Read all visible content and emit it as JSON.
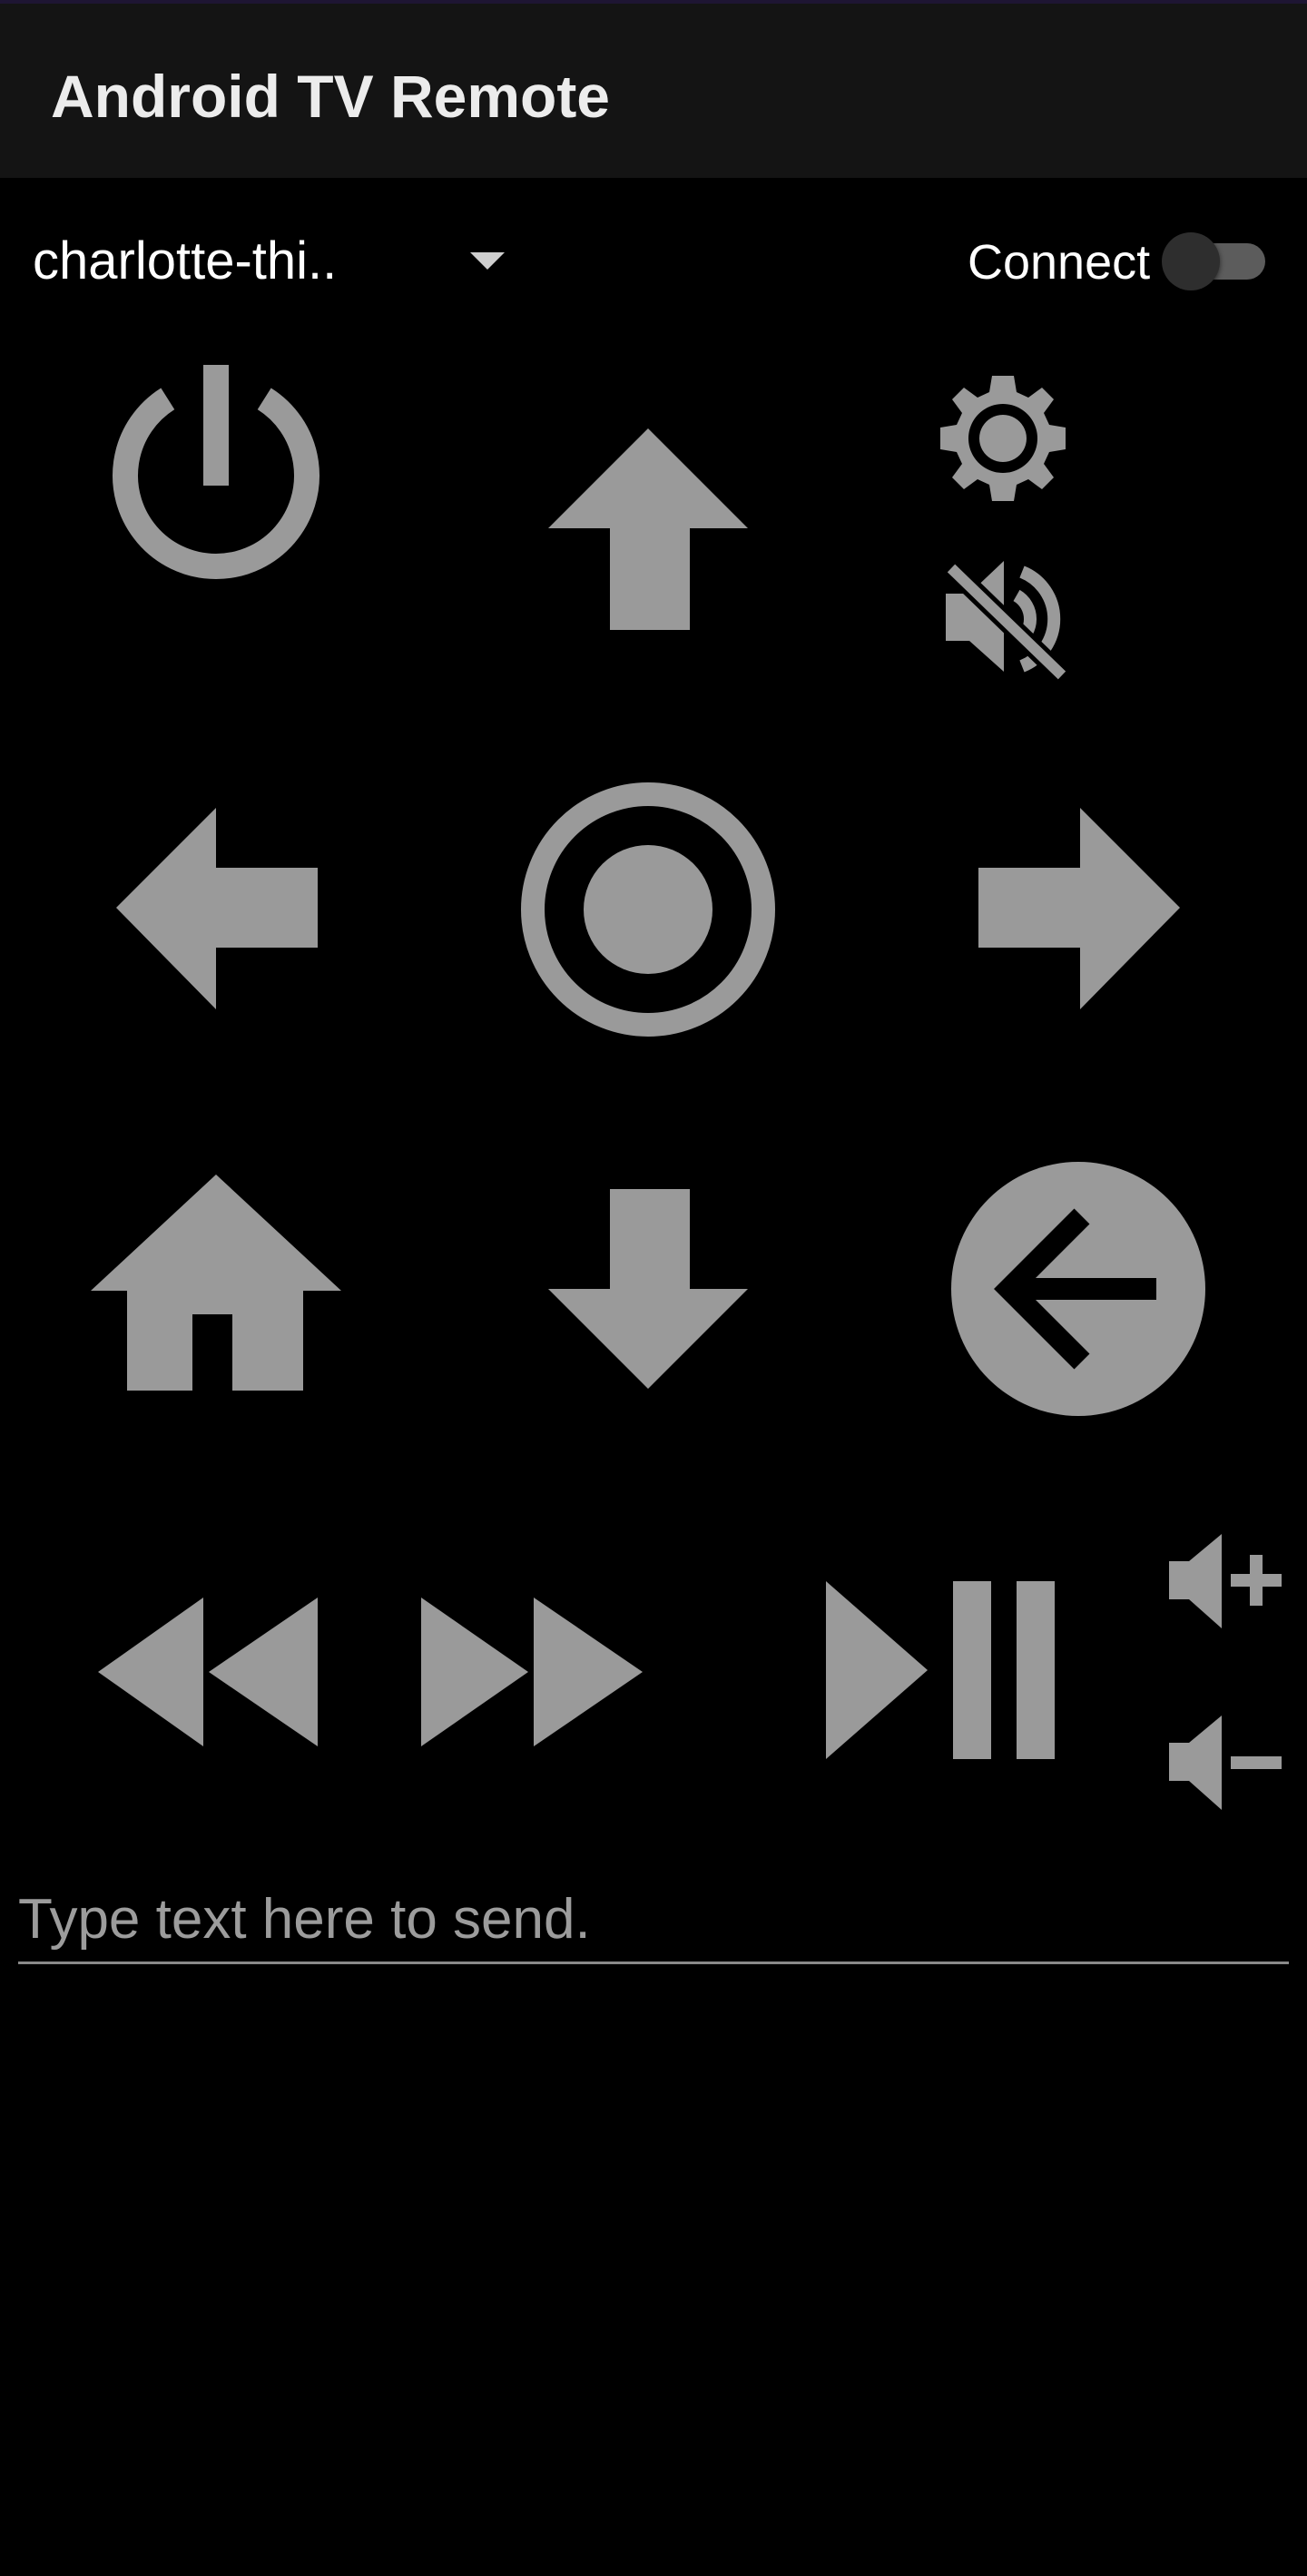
{
  "app_bar": {
    "title": "Android TV Remote"
  },
  "device": {
    "selected": "charlotte-thi..",
    "connect_label": "Connect",
    "connected": false
  },
  "remote": {
    "icons": {
      "power": "power-icon",
      "up": "arrow-up-icon",
      "settings": "gear-icon",
      "mute": "volume-off-icon",
      "left": "arrow-left-icon",
      "ok": "radio-button-checked-icon",
      "right": "arrow-right-icon",
      "home": "home-icon",
      "down": "arrow-down-icon",
      "back": "back-circle-icon",
      "rewind": "rewind-icon",
      "fast_forward": "fast-forward-icon",
      "play_pause": "play-pause-icon",
      "volume_up": "volume-up-icon",
      "volume_down": "volume-down-icon"
    }
  },
  "text_input": {
    "value": "",
    "placeholder": "Type text here to send."
  },
  "colors": {
    "background": "#000000",
    "app_bar": "#141414",
    "icon": "#9a9a9a",
    "text": "#ffffff",
    "placeholder": "#9c9c9c"
  }
}
